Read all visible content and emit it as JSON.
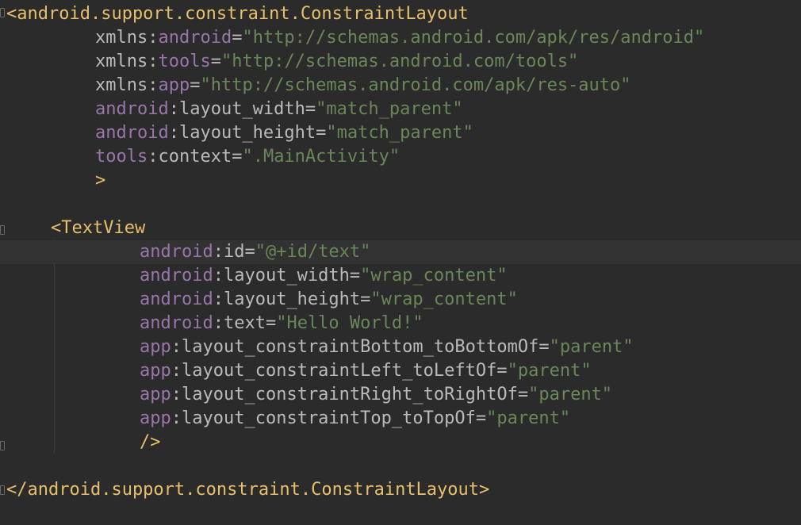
{
  "colors": {
    "background": "#2b2b2b",
    "caret_line": "#323232",
    "tag": "#e8bf6a",
    "attribute": "#bababa",
    "namespace": "#9876aa",
    "string": "#6a8759"
  },
  "code": {
    "open_tag": "<android.support.constraint.ConstraintLayout",
    "attrs": [
      {
        "ns": "xmlns",
        "sep": ":",
        "name": "android",
        "eq": "=",
        "value": "\"http://schemas.android.com/apk/res/android\""
      },
      {
        "ns": "xmlns",
        "sep": ":",
        "name": "tools",
        "eq": "=",
        "value": "\"http://schemas.android.com/tools\""
      },
      {
        "ns": "xmlns",
        "sep": ":",
        "name": "app",
        "eq": "=",
        "value": "\"http://schemas.android.com/apk/res-auto\""
      },
      {
        "ns": "android",
        "sep": ":",
        "name": "layout_width",
        "eq": "=",
        "value": "\"match_parent\""
      },
      {
        "ns": "android",
        "sep": ":",
        "name": "layout_height",
        "eq": "=",
        "value": "\"match_parent\""
      },
      {
        "ns": "tools",
        "sep": ":",
        "name": "context",
        "eq": "=",
        "value": "\".MainActivity\""
      }
    ],
    "open_tag_close": ">",
    "child_tag": "<TextView",
    "child_attrs": [
      {
        "ns": "android",
        "sep": ":",
        "name": "id",
        "eq": "=",
        "value": "\"@+id/text\""
      },
      {
        "ns": "android",
        "sep": ":",
        "name": "layout_width",
        "eq": "=",
        "value": "\"wrap_content\""
      },
      {
        "ns": "android",
        "sep": ":",
        "name": "layout_height",
        "eq": "=",
        "value": "\"wrap_content\""
      },
      {
        "ns": "android",
        "sep": ":",
        "name": "text",
        "eq": "=",
        "value": "\"Hello World!\""
      },
      {
        "ns": "app",
        "sep": ":",
        "name": "layout_constraintBottom_toBottomOf",
        "eq": "=",
        "value": "\"parent\""
      },
      {
        "ns": "app",
        "sep": ":",
        "name": "layout_constraintLeft_toLeftOf",
        "eq": "=",
        "value": "\"parent\""
      },
      {
        "ns": "app",
        "sep": ":",
        "name": "layout_constraintRight_toRightOf",
        "eq": "=",
        "value": "\"parent\""
      },
      {
        "ns": "app",
        "sep": ":",
        "name": "layout_constraintTop_toTopOf",
        "eq": "=",
        "value": "\"parent\""
      }
    ],
    "child_close": "/>",
    "close_tag": "</android.support.constraint.ConstraintLayout>"
  }
}
